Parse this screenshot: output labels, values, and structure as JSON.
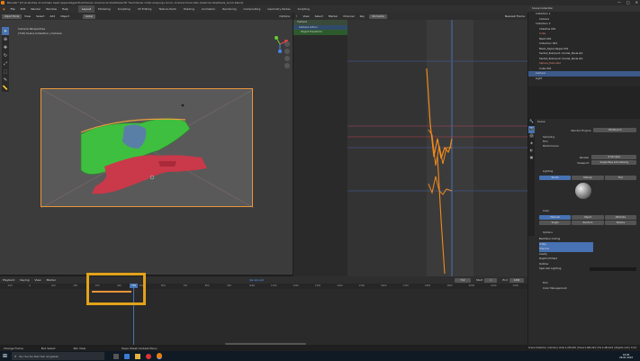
{
  "window": {
    "title": "Blender* [D:\\0 studies of animals head appendages\\Tischdiener Arianna Arriola\\Paola\\TD Tischdiener mid(runs)(sup) Ioculi, Arianna fuscicollis (head Arriola)Paola_Ioculi.blend]",
    "controls": [
      "—",
      "□",
      "✕"
    ]
  },
  "menubar": {
    "items": [
      "File",
      "Edit",
      "Render",
      "Window",
      "Help"
    ],
    "workspaces": [
      "Layout",
      "Modeling",
      "Sculpting",
      "UV Editing",
      "Texture Paint",
      "Shading",
      "Animation",
      "Rendering",
      "Compositing",
      "Geometry Nodes",
      "Scripting"
    ],
    "active_workspace": "Layout",
    "scene": "Scene",
    "view_layer": "ViewLayer"
  },
  "viewport": {
    "mode": "Object Mode",
    "menus": [
      "View",
      "Select",
      "Add",
      "Object"
    ],
    "shading": "Global",
    "options": "Options",
    "camera_label": "Camera Perspective",
    "camera_sub": "(710) Scene Collection | Camera"
  },
  "graph_editor": {
    "menus": [
      "View",
      "Select",
      "Marker",
      "Channel",
      "Key"
    ],
    "normalize": "Normalize",
    "pivot": "Nearest Frame",
    "channels": [
      "Camera",
      "Camera Action",
      "Object Transform"
    ]
  },
  "outliner": {
    "title": "Scene Collection",
    "rows": [
      "Collection 1",
      "Camera",
      "Collection 2",
      "Intestine 001",
      "Cube",
      "Mesh 001",
      "Collection 003",
      "Mesh_Appendages 001",
      "Sacteil_Bumper1 (model_Paola.stl)",
      "Sacteil_Bumper2 (model_Paola.stl)",
      "Sphere_Pods 002",
      "Cube 001",
      "Camera",
      "Light"
    ]
  },
  "properties": {
    "scene_label": "Scene",
    "render_engine_label": "Render Engine",
    "render_engine": "Workbench",
    "sections": [
      "Sampling",
      "Film",
      "Performance"
    ],
    "render_label": "Render",
    "render_value": "8 Samples",
    "viewport_label": "Viewport",
    "viewport_value": "Single Pass Anti-Aliasing",
    "lighting_title": "Lighting",
    "lighting_tabs": [
      "Studio",
      "Matcap",
      "Flat"
    ],
    "color_title": "Color",
    "color_tabs": [
      "Material",
      "Object",
      "Attribute",
      "Single",
      "Random",
      "Texture"
    ],
    "options_title": "Options",
    "options": [
      "Backface Culling",
      "X-Ray",
      "Shadow",
      "Cavity",
      "Depth Of Field",
      "Outline",
      "Specular Lighting"
    ],
    "footer": [
      "Film",
      "Color Management"
    ]
  },
  "timeline": {
    "menus": [
      "Playback",
      "Keying",
      "View",
      "Marker"
    ],
    "current_frame": "710",
    "start_label": "Start",
    "start": "1",
    "end_label": "End",
    "end": "1200",
    "ticks": [
      "-100",
      "0",
      "100",
      "200",
      "300",
      "400",
      "500",
      "600",
      "700",
      "800",
      "900",
      "1000",
      "1100",
      "1200",
      "1300",
      "1400",
      "1500",
      "1600",
      "1700",
      "1800",
      "1900",
      "2000",
      "2100",
      "2200"
    ]
  },
  "statusbar": {
    "items": [
      "Change Frame",
      "Box Select",
      "Pan View",
      "Dope Sheet Context Menu"
    ],
    "right": "Scene Collection | Camera | Verts 1,245,002 | Faces 2,481,024 | Tris 2,481,024 | Objects 1/12 | 3.0.0"
  },
  "taskbar": {
    "search_placeholder": "Zur Suche Text hier eingeben",
    "time": "16:05",
    "date": "26.01.2022"
  },
  "colors": {
    "accent": "#4772b3",
    "fcurve": "#f08a1c",
    "highlight_box": "#e3a21a",
    "keyframe": "#e8963a"
  }
}
